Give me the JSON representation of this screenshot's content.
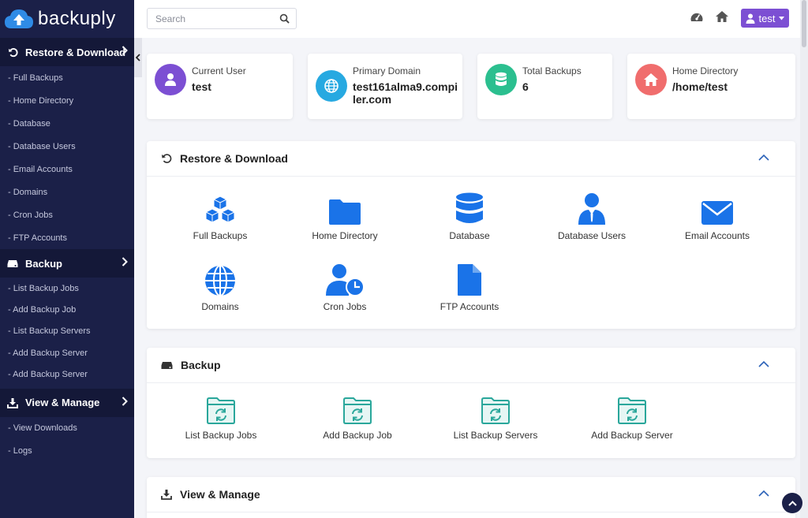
{
  "app": {
    "name": "backuply"
  },
  "sidebar": {
    "sections": [
      {
        "label": "Restore & Download",
        "items": [
          "- Full Backups",
          "- Home Directory",
          "- Database",
          "- Database Users",
          "- Email Accounts",
          "- Domains",
          "- Cron Jobs",
          "- FTP Accounts"
        ]
      },
      {
        "label": "Backup",
        "items": [
          "- List Backup Jobs",
          "- Add Backup Job",
          "- List Backup Servers",
          "- Add Backup Server",
          "- Add Backup Server"
        ]
      },
      {
        "label": "View & Manage",
        "items": [
          "- View Downloads",
          "- Logs"
        ]
      }
    ]
  },
  "header": {
    "search": {
      "placeholder": "Search",
      "value": ""
    },
    "user_label": "test"
  },
  "stats": [
    {
      "label": "Current User",
      "value": "test",
      "color": "#7c4fd3",
      "icon": "user-icon"
    },
    {
      "label": "Primary Domain",
      "value": "test161alma9.compiler.com",
      "color": "#27a9e1",
      "icon": "globe-icon"
    },
    {
      "label": "Total Backups",
      "value": "6",
      "color": "#2bbf8f",
      "icon": "database-icon"
    },
    {
      "label": "Home Directory",
      "value": "/home/test",
      "color": "#f06d6d",
      "icon": "home-icon"
    }
  ],
  "panels": {
    "restore": {
      "title": "Restore & Download",
      "tiles": [
        "Full Backups",
        "Home Directory",
        "Database",
        "Database Users",
        "Email Accounts",
        "Domains",
        "Cron Jobs",
        "FTP Accounts"
      ]
    },
    "backup": {
      "title": "Backup",
      "tiles": [
        "List Backup Jobs",
        "Add Backup Job",
        "List Backup Servers",
        "Add Backup Server"
      ]
    },
    "manage": {
      "title": "View & Manage"
    }
  },
  "colors": {
    "sidebar": "#1b2048",
    "accent": "#1a73e8",
    "teal": "#2aa79b",
    "user_button": "#7c4fd3"
  }
}
